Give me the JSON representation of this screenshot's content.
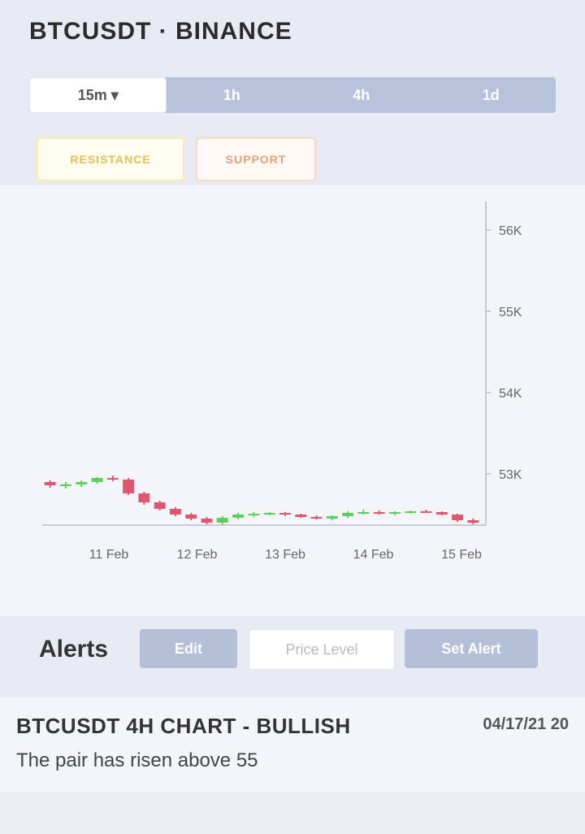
{
  "header": {
    "title": "BTCUSDT · BINANCE"
  },
  "timeframes": {
    "active": "15m ▾",
    "items": [
      "1h",
      "4h",
      "1d"
    ]
  },
  "tags": {
    "resistance": "RESISTANCE",
    "support": "SUPPORT"
  },
  "chart_data": {
    "type": "candlestick",
    "price_ticks": [
      "56K",
      "55K",
      "54K",
      "53K"
    ],
    "time_labels": [
      "11 Feb",
      "12 Feb",
      "13 Feb",
      "14 Feb",
      "15 Feb"
    ],
    "colors": {
      "up": "#5ecf5e",
      "down": "#e0566f",
      "axis": "#c8cbd6",
      "wick": "#9aa0ac"
    },
    "ylim": [
      52.35,
      56.25
    ],
    "candles": [
      [
        52.9,
        52.92,
        52.83,
        52.86
      ],
      [
        52.86,
        52.9,
        52.82,
        52.87
      ],
      [
        52.87,
        52.92,
        52.84,
        52.9
      ],
      [
        52.9,
        52.96,
        52.88,
        52.95
      ],
      [
        52.95,
        52.98,
        52.91,
        52.93
      ],
      [
        52.93,
        52.95,
        52.74,
        52.76
      ],
      [
        52.76,
        52.78,
        52.62,
        52.65
      ],
      [
        52.65,
        52.67,
        52.55,
        52.57
      ],
      [
        52.57,
        52.59,
        52.48,
        52.5
      ],
      [
        52.5,
        52.52,
        52.43,
        52.45
      ],
      [
        52.45,
        52.47,
        52.38,
        52.4
      ],
      [
        52.4,
        52.48,
        52.38,
        52.46
      ],
      [
        52.46,
        52.52,
        52.44,
        52.5
      ],
      [
        52.5,
        52.53,
        52.47,
        52.51
      ],
      [
        52.51,
        52.53,
        52.49,
        52.52
      ],
      [
        52.52,
        52.53,
        52.48,
        52.5
      ],
      [
        52.5,
        52.51,
        52.46,
        52.47
      ],
      [
        52.47,
        52.49,
        52.44,
        52.45
      ],
      [
        52.45,
        52.49,
        52.43,
        52.48
      ],
      [
        52.48,
        52.54,
        52.46,
        52.52
      ],
      [
        52.52,
        52.56,
        52.5,
        52.53
      ],
      [
        52.53,
        52.55,
        52.5,
        52.51
      ],
      [
        52.51,
        52.54,
        52.49,
        52.53
      ],
      [
        52.53,
        52.55,
        52.51,
        52.54
      ],
      [
        52.54,
        52.56,
        52.52,
        52.53
      ],
      [
        52.53,
        52.54,
        52.49,
        52.5
      ],
      [
        52.5,
        52.51,
        52.41,
        52.43
      ],
      [
        52.43,
        52.45,
        52.38,
        52.4
      ]
    ]
  },
  "alerts": {
    "label": "Alerts",
    "edit_label": "Edit",
    "price_placeholder": "Price Level",
    "set_label": "Set Alert",
    "items": [
      {
        "title": "BTCUSDT 4H CHART - BULLISH",
        "time": "04/17/21 20",
        "desc": "The pair has risen above 55"
      }
    ]
  }
}
